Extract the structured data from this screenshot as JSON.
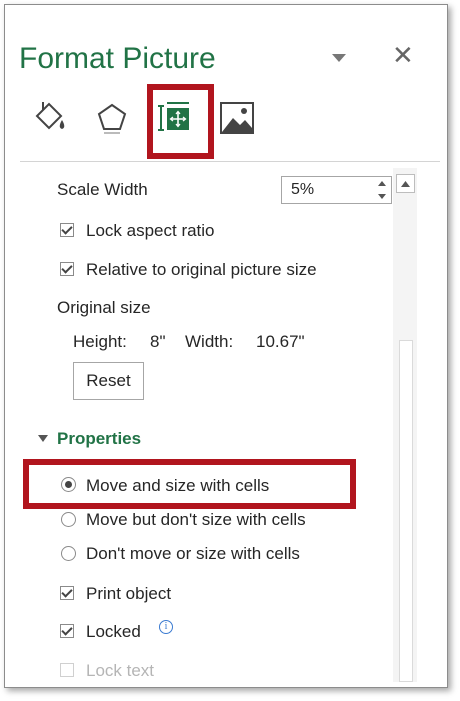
{
  "pane": {
    "title": "Format Picture",
    "close_glyph": "✕"
  },
  "icon_tabs": [
    {
      "name": "fill-line-icon",
      "active": false
    },
    {
      "name": "effects-icon",
      "active": false
    },
    {
      "name": "size-properties-icon",
      "active": true
    },
    {
      "name": "picture-icon",
      "active": false
    }
  ],
  "size": {
    "scale_width_label": "Scale Width",
    "scale_width_value": "5%",
    "lock_aspect_label": "Lock aspect ratio",
    "lock_aspect_checked": true,
    "relative_label": "Relative to original picture size",
    "relative_checked": true,
    "original_size_label": "Original size",
    "height_label": "Height:",
    "height_value": "8\"",
    "width_label": "Width:",
    "width_value": "10.67\"",
    "reset_label": "Reset"
  },
  "properties": {
    "section_title": "Properties",
    "radio_options": [
      {
        "label": "Move and size with cells",
        "selected": true
      },
      {
        "label": "Move but don't size with cells",
        "selected": false
      },
      {
        "label": "Don't move or size with cells",
        "selected": false
      }
    ],
    "print_object_label": "Print object",
    "print_object_checked": true,
    "locked_label": "Locked",
    "locked_checked": true,
    "info_glyph": "i",
    "lock_text_label": "Lock text",
    "lock_text_checked": false
  },
  "colors": {
    "accent": "#217346",
    "highlight": "#b1151e"
  }
}
